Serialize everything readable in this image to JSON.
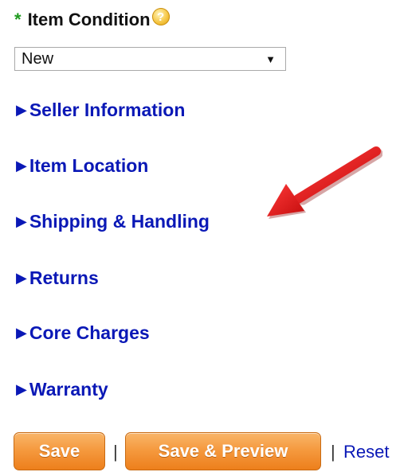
{
  "form": {
    "required_marker": "*",
    "condition_label": "Item Condition",
    "help_glyph": "?",
    "condition_value": "New",
    "dropdown_caret": "▼"
  },
  "sections": {
    "expand_glyph": "▶",
    "seller": "Seller Information",
    "location": "Item Location",
    "shipping": "Shipping & Handling",
    "returns": "Returns",
    "core": "Core Charges",
    "warranty": "Warranty"
  },
  "annotation": {
    "arrow_color": "#e01616",
    "points_to": "Shipping & Handling"
  },
  "actions": {
    "save": "Save",
    "separator": "|",
    "save_preview": "Save & Preview",
    "reset": "Reset"
  },
  "colors": {
    "link_blue": "#0a18b6",
    "required_green": "#1e9a1e",
    "button_orange": "#f59a3f"
  }
}
